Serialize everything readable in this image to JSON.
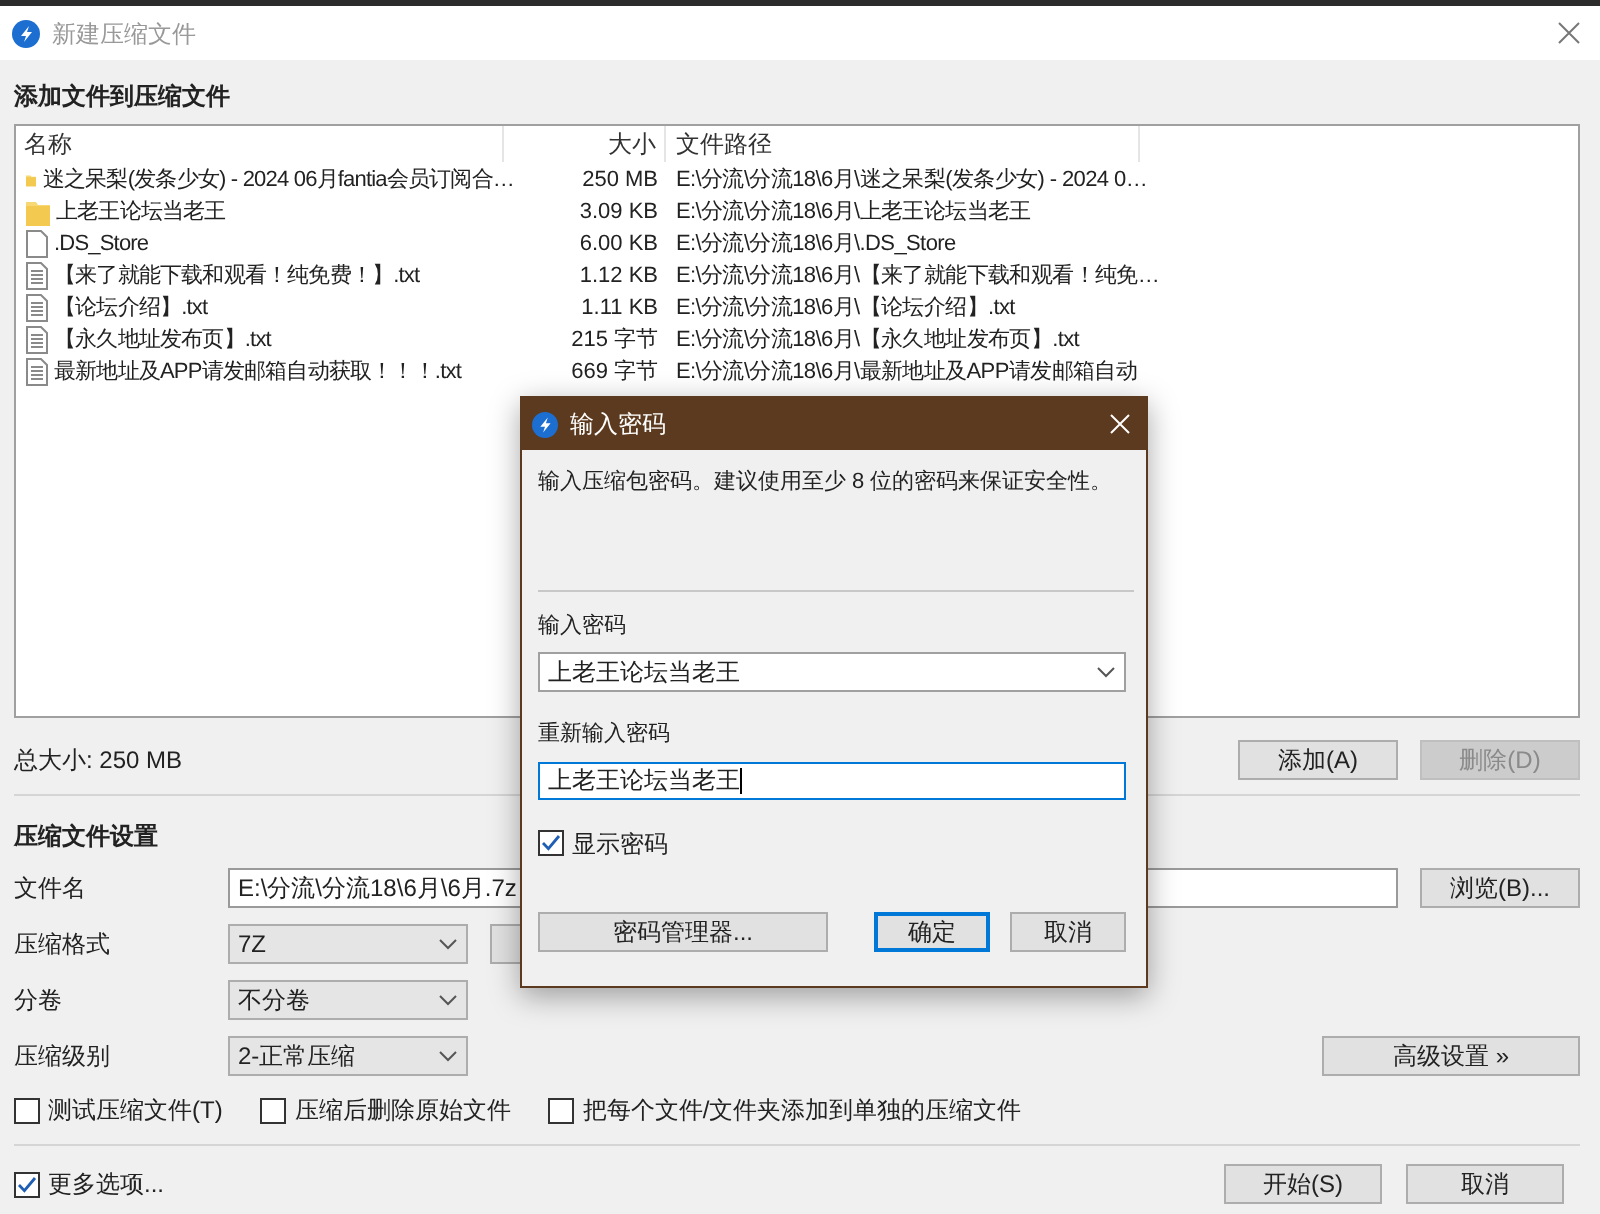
{
  "window": {
    "title": "新建压缩文件"
  },
  "files_section": {
    "heading": "添加文件到压缩文件",
    "columns": [
      "名称",
      "大小",
      "文件路径"
    ],
    "rows": [
      {
        "kind": "folder",
        "name": "迷之呆梨(发条少女) - 2024 06月fantia会员订阅合…",
        "size": "250 MB",
        "path": "E:\\分流\\分流18\\6月\\迷之呆梨(发条少女) - 2024 0…"
      },
      {
        "kind": "folder",
        "name": "上老王论坛当老王",
        "size": "3.09 KB",
        "path": "E:\\分流\\分流18\\6月\\上老王论坛当老王"
      },
      {
        "kind": "file",
        "name": ".DS_Store",
        "size": "6.00 KB",
        "path": "E:\\分流\\分流18\\6月\\.DS_Store"
      },
      {
        "kind": "text",
        "name": "【来了就能下载和观看！纯免费！】.txt",
        "size": "1.12 KB",
        "path": "E:\\分流\\分流18\\6月\\【来了就能下载和观看！纯免…"
      },
      {
        "kind": "text",
        "name": "【论坛介绍】.txt",
        "size": "1.11 KB",
        "path": "E:\\分流\\分流18\\6月\\【论坛介绍】.txt"
      },
      {
        "kind": "text",
        "name": "【永久地址发布页】.txt",
        "size": "215 字节",
        "path": "E:\\分流\\分流18\\6月\\【永久地址发布页】.txt"
      },
      {
        "kind": "text",
        "name": "最新地址及APP请发邮箱自动获取！！！.txt",
        "size": "669 字节",
        "path": "E:\\分流\\分流18\\6月\\最新地址及APP请发邮箱自动"
      }
    ]
  },
  "total_size": "总大小: 250 MB",
  "list_buttons": [
    {
      "label": "添加(A)",
      "disabled": false
    },
    {
      "label": "删除(D)",
      "disabled": true
    }
  ],
  "settings": {
    "heading": "压缩文件设置",
    "filename": {
      "label": "文件名",
      "value": "E:\\分流\\分流18\\6月\\6月.7z"
    },
    "browse_button": "浏览(B)...",
    "selects": [
      {
        "label": "压缩格式",
        "value": "7Z"
      },
      {
        "label": "分卷",
        "value": "不分卷"
      },
      {
        "label": "压缩级别",
        "value": "2-正常压缩"
      }
    ],
    "advanced_button": "高级设置 »",
    "options": [
      {
        "label": "测试压缩文件(T)",
        "checked": false
      },
      {
        "label": "压缩后删除原始文件",
        "checked": false
      },
      {
        "label": "把每个文件/文件夹添加到单独的压缩文件",
        "checked": false
      }
    ]
  },
  "more_options": {
    "label": "更多选项...",
    "checked": true
  },
  "footer_buttons": [
    "开始(S)",
    "取消"
  ],
  "dialog": {
    "title": "输入密码",
    "description": "输入压缩包密码。建议使用至少 8 位的密码来保证安全性。",
    "password_label": "输入密码",
    "password": "上老王论坛当老王",
    "confirm_label": "重新输入密码",
    "confirm": "上老王论坛当老王",
    "show_password": {
      "label": "显示密码",
      "checked": true
    },
    "manager_button": "密码管理器...",
    "ok_button": "确定",
    "cancel_button": "取消"
  }
}
